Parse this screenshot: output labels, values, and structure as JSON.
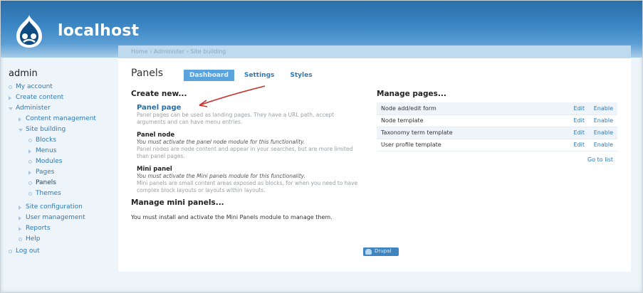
{
  "site": {
    "name": "localhost"
  },
  "breadcrumb": "Home › Administer › Site building",
  "sidebar": {
    "user": "admin",
    "items": [
      {
        "label": "My account",
        "level": 0,
        "marker": "dot"
      },
      {
        "label": "Create content",
        "level": 0,
        "marker": "tri"
      },
      {
        "label": "Administer",
        "level": 0,
        "marker": "tri-down"
      },
      {
        "label": "Content management",
        "level": 1,
        "marker": "tri"
      },
      {
        "label": "Site building",
        "level": 1,
        "marker": "tri-down"
      },
      {
        "label": "Blocks",
        "level": 2,
        "marker": "dot"
      },
      {
        "label": "Menus",
        "level": 2,
        "marker": "tri"
      },
      {
        "label": "Modules",
        "level": 2,
        "marker": "dot"
      },
      {
        "label": "Pages",
        "level": 2,
        "marker": "tri"
      },
      {
        "label": "Panels",
        "level": 2,
        "marker": "dot",
        "active": true
      },
      {
        "label": "Themes",
        "level": 2,
        "marker": "dot"
      },
      {
        "label": "Site configuration",
        "level": 1,
        "marker": "tri"
      },
      {
        "label": "User management",
        "level": 1,
        "marker": "tri"
      },
      {
        "label": "Reports",
        "level": 1,
        "marker": "tri"
      },
      {
        "label": "Help",
        "level": 1,
        "marker": "dot"
      },
      {
        "label": "Log out",
        "level": 0,
        "marker": "dot"
      }
    ]
  },
  "main": {
    "title": "Panels",
    "tabs": [
      {
        "label": "Dashboard",
        "active": true
      },
      {
        "label": "Settings",
        "active": false
      },
      {
        "label": "Styles",
        "active": false
      }
    ],
    "create_new": {
      "heading": "Create new...",
      "panel_page": {
        "title": "Panel page",
        "desc": "Panel pages can be used as landing pages. They have a URL path, accept arguments and can have menu entries."
      },
      "panel_node": {
        "title": "Panel node",
        "notice": "You must activate the panel node module for this functionality.",
        "desc": "Panel nodes are node content and appear in your searches, but are more limited than panel pages."
      },
      "mini_panel": {
        "title": "Mini panel",
        "notice": "You must activate the Mini panels module for this functionality.",
        "desc": "Mini panels are small content areas exposed as blocks, for when you need to have complex block layouts or layouts within layouts."
      }
    },
    "manage_mini": {
      "heading": "Manage mini panels...",
      "text": "You must install and activate the Mini Panels module to manage them."
    },
    "manage_pages": {
      "heading": "Manage pages...",
      "rows": [
        {
          "name": "Node add/edit form",
          "edit": "Edit",
          "enable": "Enable"
        },
        {
          "name": "Node template",
          "edit": "Edit",
          "enable": "Enable"
        },
        {
          "name": "Taxonomy term template",
          "edit": "Edit",
          "enable": "Enable"
        },
        {
          "name": "User profile template",
          "edit": "Edit",
          "enable": "Enable"
        }
      ],
      "goto": "Go to list"
    },
    "footer_badge": "Drupal"
  },
  "colors": {
    "link": "#2e78b7",
    "header": "#3c87c5",
    "arrow": "#c8302c"
  }
}
